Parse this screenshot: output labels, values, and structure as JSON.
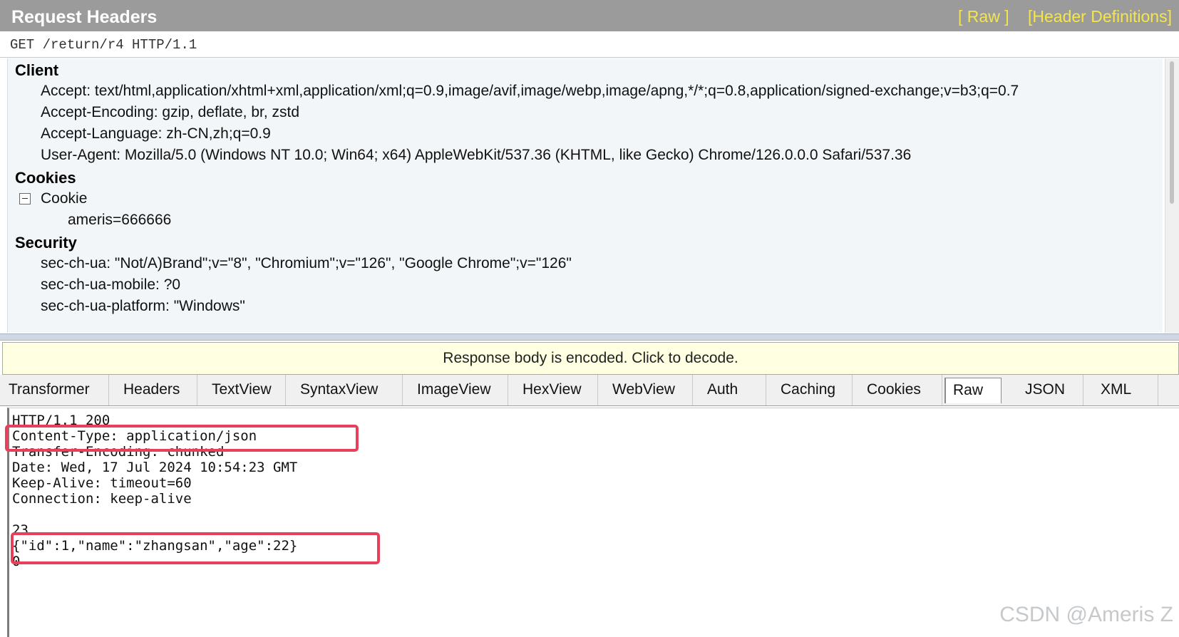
{
  "request_headers": {
    "title": "Request Headers",
    "links": [
      "[ Raw ]",
      "[Header Definitions]"
    ],
    "request_line": "GET /return/r4 HTTP/1.1",
    "groups": {
      "client": {
        "label": "Client",
        "items": [
          "Accept: text/html,application/xhtml+xml,application/xml;q=0.9,image/avif,image/webp,image/apng,*/*;q=0.8,application/signed-exchange;v=b3;q=0.7",
          "Accept-Encoding: gzip, deflate, br, zstd",
          "Accept-Language: zh-CN,zh;q=0.9",
          "User-Agent: Mozilla/5.0 (Windows NT 10.0; Win64; x64) AppleWebKit/537.36 (KHTML, like Gecko) Chrome/126.0.0.0 Safari/537.36"
        ]
      },
      "cookies": {
        "label": "Cookies",
        "cookie_label": "Cookie",
        "cookie_value": "ameris=666666"
      },
      "security": {
        "label": "Security",
        "items": [
          "sec-ch-ua: \"Not/A)Brand\";v=\"8\", \"Chromium\";v=\"126\", \"Google Chrome\";v=\"126\"",
          "sec-ch-ua-mobile: ?0",
          "sec-ch-ua-platform: \"Windows\""
        ]
      }
    }
  },
  "notice": "Response body is encoded. Click to decode.",
  "tabs": [
    "Transformer",
    "Headers",
    "TextView",
    "SyntaxView",
    "ImageView",
    "HexView",
    "WebView",
    "Auth",
    "Caching",
    "Cookies",
    "Raw",
    "JSON",
    "XML"
  ],
  "active_tab": "Raw",
  "response_raw": [
    "HTTP/1.1 200",
    "Content-Type: application/json",
    "Transfer-Encoding: chunked",
    "Date: Wed, 17 Jul 2024 10:54:23 GMT",
    "Keep-Alive: timeout=60",
    "Connection: keep-alive",
    "",
    "23",
    "{\"id\":1,\"name\":\"zhangsan\",\"age\":22}",
    "0"
  ],
  "watermark": "CSDN @Ameris Z",
  "colors": {
    "header_bar": "#9b9b9b",
    "header_links": "#f4e64a",
    "highlight": "#e8405a",
    "notice_bg": "#ffffe1",
    "tree_bg": "#f2f6f8"
  }
}
